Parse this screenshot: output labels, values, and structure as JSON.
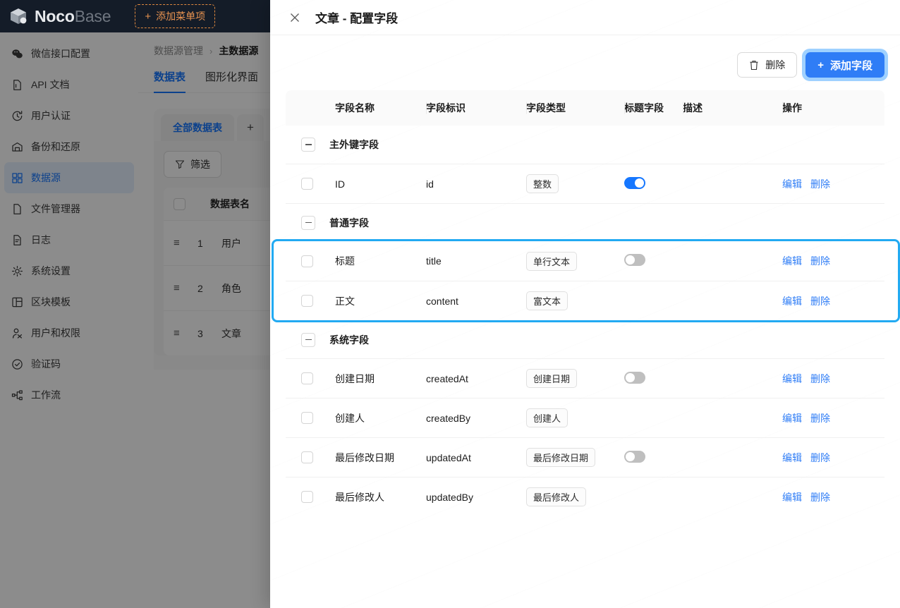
{
  "topbar": {
    "logo_noco": "Noco",
    "logo_base": "Base",
    "add_menu_label": "添加菜单项",
    "plus": "+"
  },
  "sidebar": {
    "items": [
      {
        "label": "微信接口配置",
        "icon": "wechat-icon",
        "active": false
      },
      {
        "label": "API 文档",
        "icon": "file-code-icon",
        "active": false
      },
      {
        "label": "用户认证",
        "icon": "clock-arrow-icon",
        "active": false
      },
      {
        "label": "备份和还原",
        "icon": "archive-icon",
        "active": false
      },
      {
        "label": "数据源",
        "icon": "database-icon",
        "active": true
      },
      {
        "label": "文件管理器",
        "icon": "file-icon",
        "active": false
      },
      {
        "label": "日志",
        "icon": "file-lines-icon",
        "active": false
      },
      {
        "label": "系统设置",
        "icon": "gear-icon",
        "active": false
      },
      {
        "label": "区块模板",
        "icon": "layout-icon",
        "active": false
      },
      {
        "label": "用户和权限",
        "icon": "users-icon",
        "active": false
      },
      {
        "label": "验证码",
        "icon": "check-circle-icon",
        "active": false
      },
      {
        "label": "工作流",
        "icon": "workflow-icon",
        "active": false
      }
    ]
  },
  "background": {
    "breadcrumb": {
      "root": "数据源管理",
      "separator": "›",
      "current": "主数据源"
    },
    "tabs": [
      {
        "label": "数据表",
        "active": true
      },
      {
        "label": "图形化界面",
        "active": false
      }
    ],
    "sub_tabs": [
      {
        "label": "全部数据表",
        "active": true
      },
      {
        "label": "+",
        "active": false
      }
    ],
    "filter_label": "筛选",
    "table": {
      "headers": [
        "数据表名"
      ],
      "rows": [
        {
          "index": "1",
          "name": "用户"
        },
        {
          "index": "2",
          "name": "角色"
        },
        {
          "index": "3",
          "name": "文章"
        }
      ]
    }
  },
  "drawer": {
    "title": "文章 - 配置字段",
    "close_label": "×",
    "actions": {
      "delete_label": "删除",
      "add_field_label": "添加字段",
      "plus": "+"
    },
    "table": {
      "headers": [
        "字段名称",
        "字段标识",
        "字段类型",
        "标题字段",
        "描述",
        "操作"
      ],
      "edit_label": "编辑",
      "delete_label": "删除",
      "groups": [
        {
          "group_label": "主外键字段",
          "collapsed": false,
          "rows": [
            {
              "name": "ID",
              "key": "id",
              "type": "整数",
              "title_field": true,
              "title_toggle_on": true,
              "desc": ""
            }
          ]
        },
        {
          "group_label": "普通字段",
          "collapsed": false,
          "highlighted": true,
          "rows": [
            {
              "name": "标题",
              "key": "title",
              "type": "单行文本",
              "title_field": true,
              "title_toggle_on": false,
              "desc": ""
            },
            {
              "name": "正文",
              "key": "content",
              "type": "富文本",
              "title_field": false,
              "title_toggle_on": false,
              "desc": ""
            }
          ]
        },
        {
          "group_label": "系统字段",
          "collapsed": false,
          "rows": [
            {
              "name": "创建日期",
              "key": "createdAt",
              "type": "创建日期",
              "title_field": true,
              "title_toggle_on": false,
              "desc": ""
            },
            {
              "name": "创建人",
              "key": "createdBy",
              "type": "创建人",
              "title_field": false,
              "title_toggle_on": false,
              "desc": ""
            },
            {
              "name": "最后修改日期",
              "key": "updatedAt",
              "type": "最后修改日期",
              "title_field": true,
              "title_toggle_on": false,
              "desc": ""
            },
            {
              "name": "最后修改人",
              "key": "updatedBy",
              "type": "最后修改人",
              "title_field": false,
              "title_toggle_on": false,
              "desc": ""
            }
          ]
        }
      ]
    }
  },
  "colors": {
    "primary": "#1677ff",
    "button_blue": "#2f7df6",
    "highlight_ring": "#22aaf2",
    "topbar_bg": "#141c28",
    "accent_orange": "#e89350"
  }
}
